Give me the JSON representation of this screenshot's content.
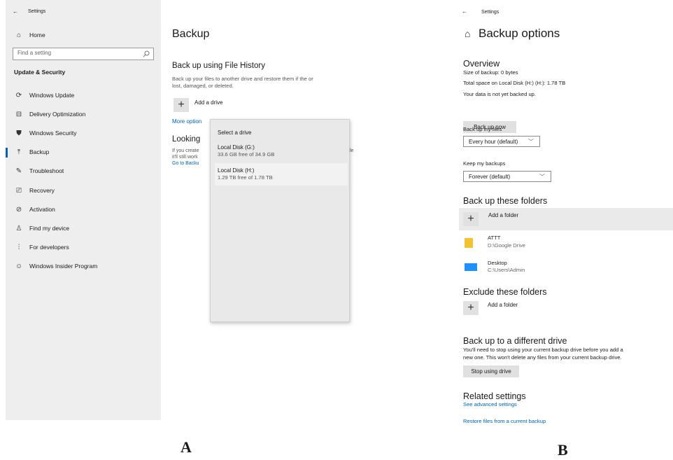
{
  "panelA": {
    "titlebar": {
      "back": "←",
      "title": "Settings"
    },
    "home": "Home",
    "search_placeholder": "Find a setting",
    "section": "Update & Security",
    "nav": [
      {
        "label": "Windows Update",
        "icon": "refresh-icon"
      },
      {
        "label": "Delivery Optimization",
        "icon": "delivery-icon"
      },
      {
        "label": "Windows Security",
        "icon": "shield-icon"
      },
      {
        "label": "Backup",
        "icon": "backup-arrow-icon"
      },
      {
        "label": "Troubleshoot",
        "icon": "wrench-icon"
      },
      {
        "label": "Recovery",
        "icon": "recovery-icon"
      },
      {
        "label": "Activation",
        "icon": "check-circle-icon"
      },
      {
        "label": "Find my device",
        "icon": "person-pin-icon"
      },
      {
        "label": "For developers",
        "icon": "sliders-icon"
      },
      {
        "label": "Windows Insider Program",
        "icon": "insider-icon"
      }
    ],
    "page_title": "Backup",
    "fh_title": "Back up using File History",
    "fh_desc1": "Back up your files to another drive and restore them if the or",
    "fh_desc2": "lost, damaged, or deleted.",
    "add_drive": "Add a drive",
    "more_options": "More option",
    "looking_title": "Looking",
    "looking_line1": "If you create",
    "looking_line2": "it'll still work",
    "looking_link": "Go to Backu",
    "looking_right": "le",
    "popup": {
      "title": "Select a drive",
      "drives": [
        {
          "name": "Local Disk (G:)",
          "info": "33.6 GB free of 34.9 GB"
        },
        {
          "name": "Local Disk (H:)",
          "info": "1.29 TB free of 1.78 TB"
        }
      ]
    },
    "caption": "A"
  },
  "panelB": {
    "titlebar": {
      "back": "←",
      "title": "Settings"
    },
    "page_title": "Backup options",
    "overview": {
      "title": "Overview",
      "size": "Size of backup: 0 bytes",
      "space": "Total space on Local Disk (H:) (H:): 1.78 TB",
      "status": "Your data is not yet backed up.",
      "button": "Back up now"
    },
    "backup_files": {
      "label": "Back up my files",
      "value": "Every hour (default)"
    },
    "keep_backups": {
      "label": "Keep my backups",
      "value": "Forever (default)"
    },
    "these_folders": {
      "title": "Back up these folders",
      "add": "Add a folder",
      "items": [
        {
          "name": "ATTT",
          "path": "D:\\Google Drive",
          "icon": "folder-icon"
        },
        {
          "name": "Desktop",
          "path": "C:\\Users\\Admin",
          "icon": "desktop-icon"
        }
      ]
    },
    "exclude": {
      "title": "Exclude these folders",
      "add": "Add a folder"
    },
    "different_drive": {
      "title": "Back up to a different drive",
      "desc1": "You'll need to stop using your current backup drive before you add a",
      "desc2": "new one. This won't delete any files from your current backup drive.",
      "button": "Stop using drive"
    },
    "related": {
      "title": "Related settings",
      "link1": "See advanced settings",
      "link2": "Restore files from a current backup"
    },
    "caption": "B"
  },
  "colors": {
    "accent": "#0063b1",
    "sidebar": "#eeeeee",
    "button": "#e0e0e0"
  }
}
